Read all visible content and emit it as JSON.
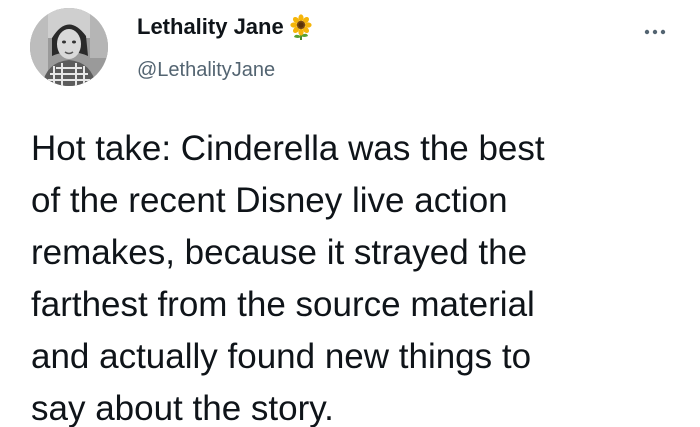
{
  "author": {
    "display_name": "Lethality Jane",
    "display_name_emoji": "sunflower-icon",
    "handle": "@LethalityJane",
    "avatar": "avatar-photo"
  },
  "actions": {
    "more_icon": "more-dots-icon"
  },
  "tweet": {
    "text": "Hot take: Cinderella was the best\nof the recent Disney live action\nremakes, because it strayed the\nfarthest from the source material\nand actually found new things to\nsay about the story."
  },
  "colors": {
    "text_primary": "#0f1419",
    "text_secondary": "#536471",
    "background": "#ffffff"
  }
}
